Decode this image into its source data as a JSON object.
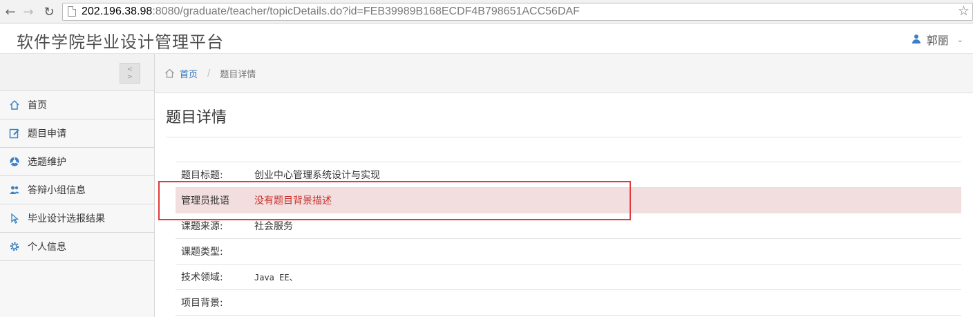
{
  "browser": {
    "url_host": "202.196.38.98",
    "url_rest": ":8080/graduate/teacher/topicDetails.do?id=FEB39989B168ECDF4B798651ACC56DAF"
  },
  "app": {
    "title": "软件学院毕业设计管理平台",
    "user_name": "郭丽"
  },
  "sidebar": {
    "items": [
      {
        "label": "首页",
        "icon": "home-icon"
      },
      {
        "label": "题目申请",
        "icon": "edit-icon"
      },
      {
        "label": "选题维护",
        "icon": "cycle-icon"
      },
      {
        "label": "答辩小组信息",
        "icon": "group-icon"
      },
      {
        "label": "毕业设计选报结果",
        "icon": "pointer-icon"
      },
      {
        "label": "个人信息",
        "icon": "gear-icon"
      }
    ]
  },
  "breadcrumb": {
    "home": "首页",
    "separator": "/",
    "current": "题目详情"
  },
  "page": {
    "title": "题目详情"
  },
  "details": [
    {
      "label": "题目标题:",
      "value": "创业中心管理系统设计与实现"
    },
    {
      "label": "管理员批语",
      "value": "没有题目背景描述"
    },
    {
      "label": "课题来源:",
      "value": "社会服务"
    },
    {
      "label": "课题类型:",
      "value": ""
    },
    {
      "label": "技术领域:",
      "value": "Java EE、"
    },
    {
      "label": "项目背景:",
      "value": ""
    }
  ],
  "colors": {
    "accent": "#3a82c4",
    "danger_bg": "#f2dede",
    "danger_text": "#c9302c",
    "highlight_border": "#e03a3a"
  }
}
